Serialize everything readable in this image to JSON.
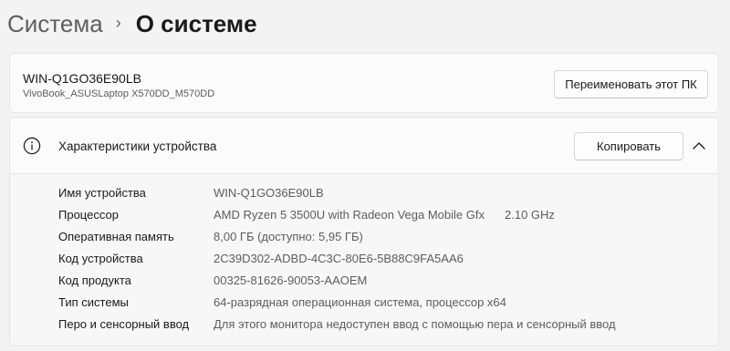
{
  "breadcrumb": {
    "parent": "Система",
    "separator": "›",
    "current": "О системе"
  },
  "pc": {
    "name": "WIN-Q1GO36E90LB",
    "model": "VivoBook_ASUSLaptop X570DD_M570DD",
    "rename_label": "Переименовать этот ПК"
  },
  "specs": {
    "title": "Характеристики устройства",
    "copy_label": "Копировать",
    "expanded": true,
    "icon": "info-icon",
    "rows": [
      {
        "label": "Имя устройства",
        "value": "WIN-Q1GO36E90LB",
        "extra": ""
      },
      {
        "label": "Процессор",
        "value": "AMD Ryzen 5 3500U with Radeon Vega Mobile Gfx",
        "extra": "2.10 GHz"
      },
      {
        "label": "Оперативная память",
        "value": "8,00 ГБ (доступно: 5,95 ГБ)",
        "extra": ""
      },
      {
        "label": "Код устройства",
        "value": "2C39D302-ADBD-4C3C-80E6-5B88C9FA5AA6",
        "extra": ""
      },
      {
        "label": "Код продукта",
        "value": "00325-81626-90053-AAOEM",
        "extra": ""
      },
      {
        "label": "Тип системы",
        "value": "64-разрядная операционная система, процессор x64",
        "extra": ""
      },
      {
        "label": "Перо и сенсорный ввод",
        "value": "Для этого монитора недоступен ввод с помощью пера и сенсорный ввод",
        "extra": ""
      }
    ]
  }
}
